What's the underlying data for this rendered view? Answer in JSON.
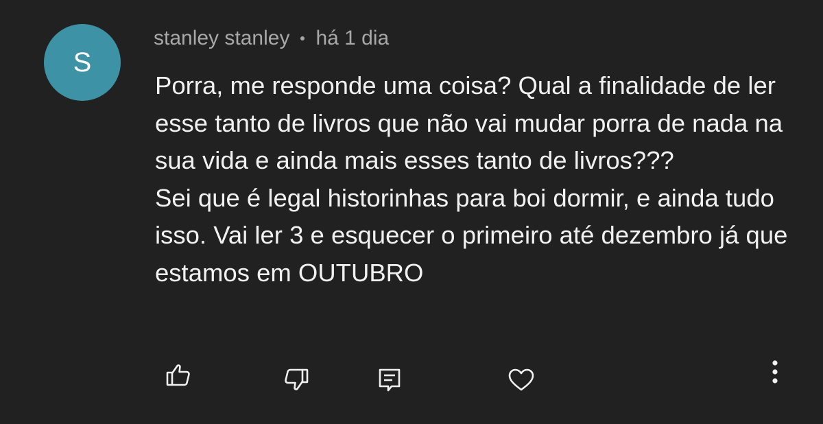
{
  "comment": {
    "avatar_letter": "S",
    "avatar_color": "#3d93a5",
    "author": "stanley stanley",
    "separator": "•",
    "time": "há 1 dia",
    "paragraphs": [
      "Porra, me responde uma coisa? Qual a finalidade de ler esse tanto de livros que não vai mudar porra de nada na sua vida e ainda mais esses tanto de livros???",
      "Sei que é legal historinhas para boi dormir, e ainda tudo isso. Vai ler 3 e esquecer o primeiro até dezembro já que estamos em OUTUBRO"
    ]
  },
  "actions": {
    "like_icon": "thumbs-up-icon",
    "dislike_icon": "thumbs-down-icon",
    "reply_icon": "reply-icon",
    "heart_icon": "heart-icon",
    "more_icon": "more-vertical-icon"
  },
  "colors": {
    "background": "#212121",
    "text": "#f1f1f1",
    "meta_text": "#a8a8a8",
    "icon": "#f1f1f1"
  }
}
